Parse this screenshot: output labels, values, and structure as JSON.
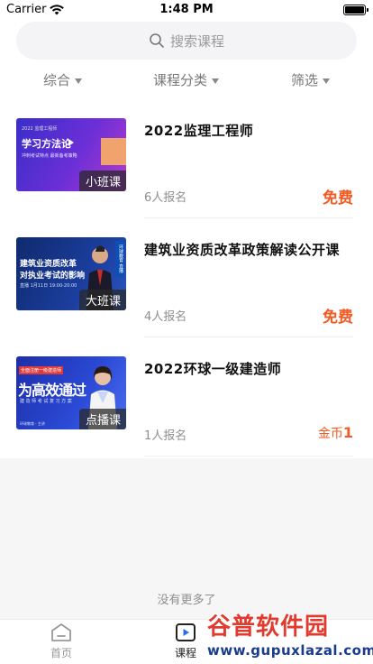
{
  "status_bar": {
    "carrier": "Carrier",
    "time": "1:48 PM",
    "battery_level": 1.0
  },
  "search": {
    "placeholder": "搜索课程"
  },
  "filters": [
    {
      "label": "综合"
    },
    {
      "label": "课程分类"
    },
    {
      "label": "筛选"
    }
  ],
  "courses": [
    {
      "title": "2022监理工程师",
      "badge": "小班课",
      "enrolled": "6人报名",
      "price": "免费",
      "thumb_small": "2022 监理工程师",
      "thumb_big": "学习方法论",
      "thumb_sub": "冲刺考试特点 最新备考策略"
    },
    {
      "title": "建筑业资质改革政策解读公开课",
      "badge": "大班课",
      "enrolled": "4人报名",
      "price": "免费",
      "thumb_line1": "建筑业资质改革",
      "thumb_line2": "对执业考试的影响",
      "thumb_meta": "直播 1月11日 19:00-20:00",
      "thumb_tag": "环球教育 直播"
    },
    {
      "title": "2022环球一级建造师",
      "badge": "点播课",
      "enrolled": "1人报名",
      "price_prefix": "金币",
      "price_amount": "1",
      "thumb_badge_top": "全面注册一级建造师",
      "thumb_big": "为高效通过",
      "thumb_meta": "建 造 师 考 试 复 习 方 案",
      "thumb_meta2": "环球教育 · 主讲"
    }
  ],
  "footer": {
    "no_more": "没有更多了"
  },
  "tab_bar": {
    "items": [
      {
        "label": "首页",
        "icon": "home-icon",
        "active": false
      },
      {
        "label": "课程",
        "icon": "course-play-icon",
        "active": true
      }
    ]
  },
  "watermark": {
    "title": "谷普软件园",
    "url": "www.gupuxlazal.com"
  },
  "colors": {
    "accent": "#f25a23",
    "muted": "#8f8f8f",
    "search_bg": "#f4f4f6",
    "page_bottom_bg": "#f6f6f7"
  }
}
